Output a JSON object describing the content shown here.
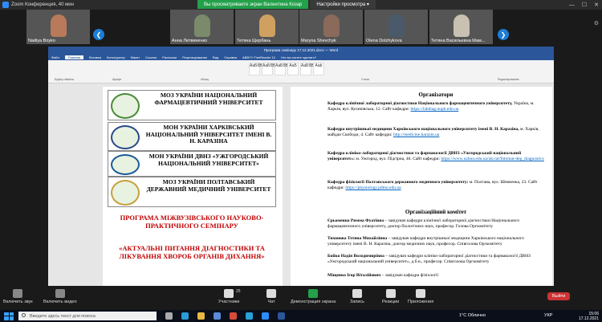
{
  "titlebar": {
    "title": "Zoom Конференция, 40 мин"
  },
  "banner": {
    "message": "Вы просматриваете экран Валентина Козар",
    "options_label": "Настройки просмотра ▾"
  },
  "participants": [
    {
      "name": "Nadiya Boyko",
      "color": "#b87a5a"
    },
    {
      "name": "Анна Литвиненко",
      "color": "#7a8a6a"
    },
    {
      "name": "Тетяна Щербань",
      "color": "#d0a060"
    },
    {
      "name": "Maryna Shevchyk",
      "color": "#8a6a5a"
    },
    {
      "name": "Olena Dolzhykova",
      "color": "#4a5a6a"
    },
    {
      "name": "Тетяна Васильевна Мам...",
      "color": "#c8c0b0"
    }
  ],
  "word": {
    "doc_title": "Програма семінару 17.12.2021.docx — Word",
    "tabs": [
      "Файл",
      "Главная",
      "Вставка",
      "Конструктор",
      "Макет",
      "Ссылки",
      "Рассылки",
      "Рецензирование",
      "Вид",
      "Справка",
      "ABBYY FineReader 12",
      "Что вы хотите сделать?"
    ],
    "styles": [
      "АаБбВ",
      "АаБбВ",
      "АаБбВ",
      "АаБ",
      "АаБбВ",
      "Aab"
    ],
    "groups": {
      "clipboard": "Буфер обмена",
      "font": "Шрифт",
      "paragraph": "Абзац",
      "styles": "Стили",
      "edit": "Редактирование"
    }
  },
  "left_page": {
    "universities": [
      {
        "text": "МОЗ УКРАЇНИ НАЦІОНАЛЬНИЙ ФАРМАЦЕВТИЧНИЙ УНІВЕРСИТЕТ",
        "logo_color": "#4a8a3a"
      },
      {
        "text": "МОН УКРАЇНИ ХАРКІВСЬКИЙ НАЦІОНАЛЬНИЙ УНІВЕРСИТЕТ ІМЕНІ В. Н. КАРАЗІНА",
        "logo_color": "#2a4a8a"
      },
      {
        "text": "МОН УКРАЇНИ ДВНЗ «УЖГОРОДСЬКИЙ НАЦІОНАЛЬНИЙ УНІВЕРСИТЕТ»",
        "logo_color": "#1a5a9a"
      },
      {
        "text": "МОЗ УКРАЇНИ ПОЛТАВСЬКИЙ ДЕРЖАВНИЙ МЕДИЧНИЙ УНІВЕРСИТЕТ",
        "logo_color": "#c8a040"
      }
    ],
    "program_title": "ПРОГРАМА МІЖВУЗІВСЬКОГО НАУКОВО-ПРАКТИЧНОГО СЕМІНАРУ",
    "program_topic": "«АКТУАЛЬНІ ПИТАННЯ ДІАГНОСТИКИ ТА ЛІКУВАННЯ ХВОРОБ ОРГАНІВ ДИХАННЯ»"
  },
  "right_page": {
    "org_heading": "Організатори",
    "org_blocks": [
      {
        "bold": "Кафедра клінічної лабораторної діагностики Національного фармацевтичного університету,",
        "text": " Україна, м. Харків, вул. Куликівська, 12.",
        "site_label": "Сайт кафедри:",
        "link": "https://labdiag.nuph.edu.ua"
      },
      {
        "bold": "Кафедра внутрішньої медицини Харківського національного університету імені В. Н. Каразіна,",
        "text": " м. Харків, майдан Свободи, 4. Сайт кафедри:",
        "site_label": "",
        "link": "http://medicine.karazin.ua"
      },
      {
        "bold": "Кафедра клініко-лабораторної діагностики та фармакології ДВНЗ «Ужгородський національний університет»:",
        "text": " м. Ужгород, вул. Підгірна, 46.",
        "site_label": "Сайт кафедри:",
        "link": "https://www.uzhnu.edu.ua/uk/cat/fntomat-dep_diagnostics"
      },
      {
        "bold": "Кафедра фізіології Полтавського державного медичного університету:",
        "text": " м. Полтава, вул. Шевченка, 23.",
        "site_label": "Сайт кафедри:",
        "link": "https://physiology.pdmu.edu.ua"
      }
    ],
    "committee_heading": "Організаційний комітет",
    "committee": [
      {
        "bold": "Єрьоменко Римма Фуатівна",
        "text": " – завідувач кафедри клінічної лабораторної діагностики Національного фармацевтичного університету, доктор біологічних наук, професор. Голова Оргкомітету"
      },
      {
        "bold": "Тихонова Тетяна Михайлівна",
        "text": " – завідувач кафедри внутрішньої медицини Харківського національного університету імені В. Н. Каразіна, доктор медичних наук, професор. Співголова Оргкомітету"
      },
      {
        "bold": "Бойко Надія Володимирівна",
        "text": " – завідувач кафедри клініко-лабораторної діагностики та фармакології ДВНЗ «Ужгородський національний університет», д.б.н., професор. Співголова Оргкомітету"
      },
      {
        "bold": "Міщенко Ігор Віталійович",
        "text": " – завідувач кафедри фізіології"
      }
    ]
  },
  "toolbar": {
    "buttons": [
      {
        "label": "Включить звук",
        "name": "unmute-button",
        "color": "#888"
      },
      {
        "label": "Включить видео",
        "name": "start-video-button",
        "color": "#888"
      },
      {
        "label": "Участники",
        "name": "participants-button",
        "color": "#ddd",
        "count": "25"
      },
      {
        "label": "Чат",
        "name": "chat-button",
        "color": "#ddd"
      },
      {
        "label": "Демонстрация экрана",
        "name": "share-screen-button",
        "color": "#23a04a"
      },
      {
        "label": "Запись",
        "name": "record-button",
        "color": "#ddd"
      },
      {
        "label": "Реакции",
        "name": "reactions-button",
        "color": "#ddd"
      },
      {
        "label": "Приложения",
        "name": "apps-button",
        "color": "#ddd"
      }
    ],
    "leave_label": "Выйти"
  },
  "taskbar": {
    "search_placeholder": "Введите здесь текст для поиска",
    "weather": "1°C Облачно",
    "lang": "УКР",
    "time": "15:06",
    "date": "17.12.2021",
    "apps": [
      {
        "name": "task-view-icon",
        "color": "#aaa"
      },
      {
        "name": "edge-icon",
        "color": "#2a9ad8"
      },
      {
        "name": "explorer-icon",
        "color": "#e8b840"
      },
      {
        "name": "store-icon",
        "color": "#5a8ad8"
      },
      {
        "name": "chrome-icon",
        "color": "#d84a3a"
      },
      {
        "name": "telegram-icon",
        "color": "#2aa0d8"
      },
      {
        "name": "zoom-icon",
        "color": "#2d8cff"
      },
      {
        "name": "word-icon",
        "color": "#2b579a"
      }
    ]
  }
}
